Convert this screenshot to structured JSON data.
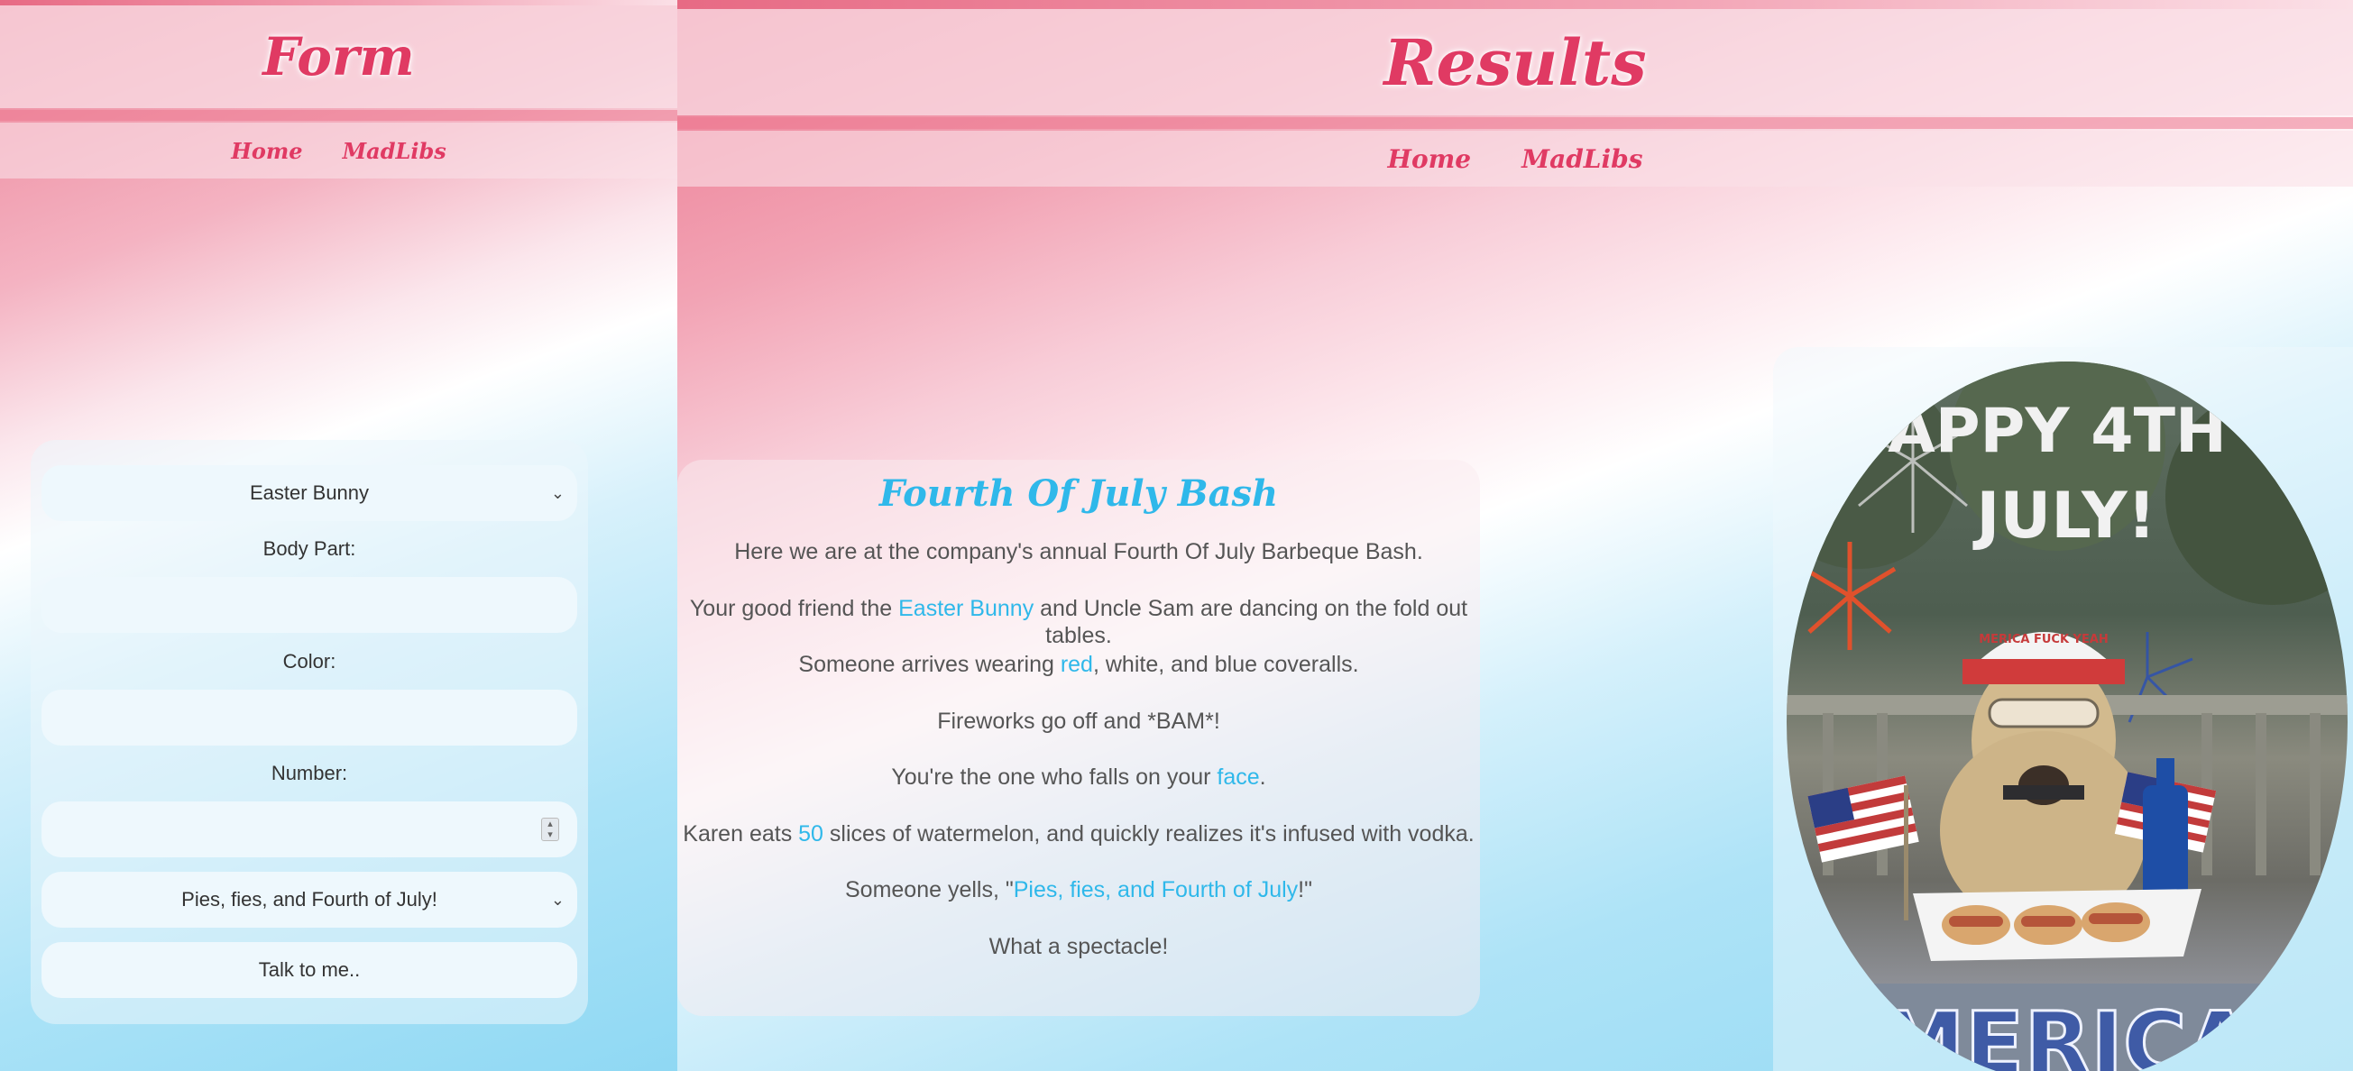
{
  "form_page": {
    "title": "Form",
    "nav": [
      "Home",
      "MadLibs"
    ],
    "fields": {
      "name_select_value": "Easter Bunny",
      "body_part_label": "Body Part:",
      "color_label": "Color:",
      "number_label": "Number:",
      "phrase_select_value": "Pies, fies, and Fourth of July!",
      "submit_label": "Talk to me.."
    }
  },
  "results_page": {
    "title": "Results",
    "nav": [
      "Home",
      "MadLibs"
    ],
    "story_title": "Fourth Of July Bash",
    "story_lines": [
      {
        "before": "Here we are at the company's annual Fourth Of July Barbeque Bash.",
        "word": "",
        "after": ""
      },
      {
        "before": "Your good friend the ",
        "word": "Easter Bunny",
        "after": " and Uncle Sam are dancing on the fold out tables."
      },
      {
        "before": "Someone arrives wearing ",
        "word": "red",
        "after": ", white, and blue coveralls."
      },
      {
        "before": "Fireworks go off and *BAM*!",
        "word": "",
        "after": ""
      },
      {
        "before": "You're the one who falls on your ",
        "word": "face",
        "after": "."
      },
      {
        "before": "Karen eats ",
        "word": "50",
        "after": " slices of watermelon, and quickly realizes it's infused with vodka."
      },
      {
        "before": "Someone yells, \"",
        "word": "Pies, fies, and Fourth of July",
        "after": "!\""
      },
      {
        "before": "What a spectacle!",
        "word": "",
        "after": ""
      }
    ],
    "image": {
      "text_top": "APPY 4TH",
      "text_mid": "JULY!",
      "text_bottom": "MERICA",
      "hat_text": "MERICA FUCK YEAH"
    }
  },
  "colors": {
    "accent_pink": "#e03a63",
    "highlight_blue": "#2fb8ea"
  }
}
